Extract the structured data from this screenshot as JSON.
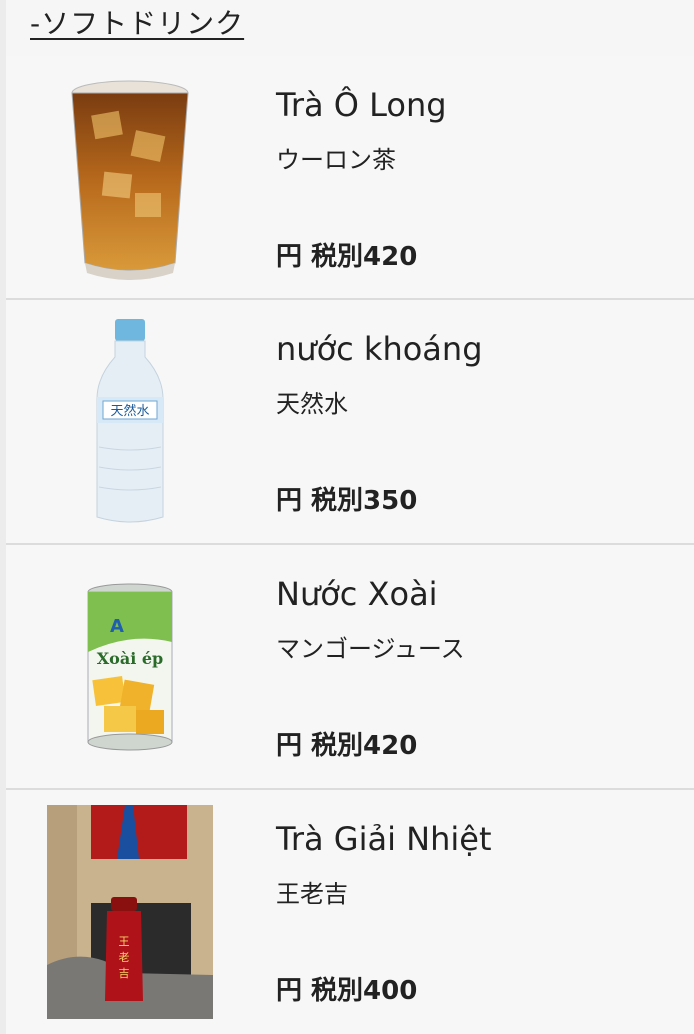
{
  "section_title": "-ソフトドリンク",
  "items": [
    {
      "name": "Trà Ô Long",
      "jp_name": "ウーロン茶",
      "price": "円 税別420",
      "image_icon": "iced-tea-glass-icon"
    },
    {
      "name": "nước khoáng",
      "jp_name": "天然水",
      "price": "円 税別350",
      "image_icon": "water-bottle-icon"
    },
    {
      "name": "Nước Xoài",
      "jp_name": "マンゴージュース",
      "price": "円 税別420",
      "image_icon": "mango-juice-can-icon"
    },
    {
      "name": "Trà Giải Nhiệt",
      "jp_name": "王老吉",
      "price": "円 税別400",
      "image_icon": "herbal-tea-bottle-photo"
    }
  ]
}
